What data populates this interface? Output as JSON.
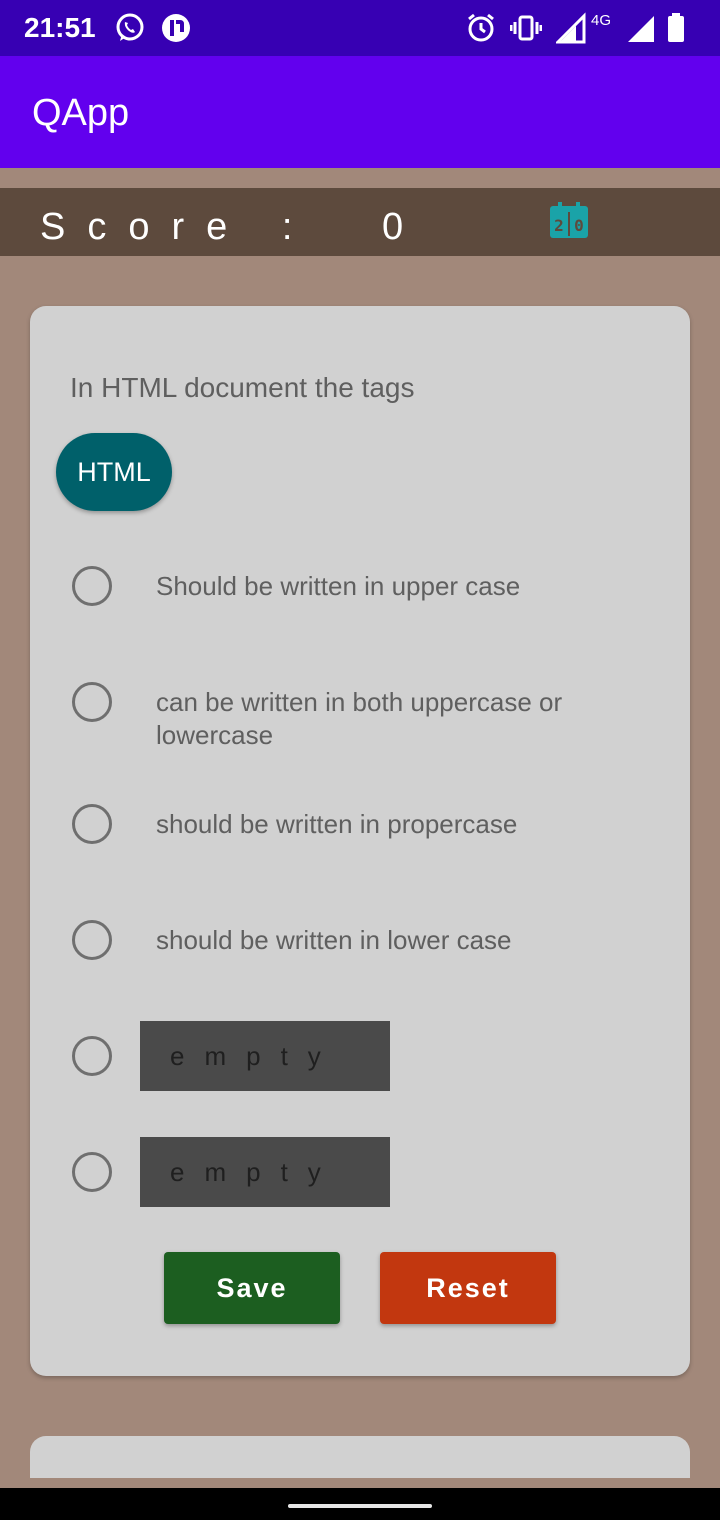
{
  "status_bar": {
    "time": "21:51",
    "network": "4G",
    "icons": [
      "whatsapp-icon",
      "app-notification-icon",
      "alarm-icon",
      "vibrate-icon",
      "signal-icon",
      "signal-full-icon",
      "battery-icon"
    ]
  },
  "app_bar": {
    "title": "QApp"
  },
  "score": {
    "label": "Score :",
    "value": "0",
    "icon": "scoreboard-icon"
  },
  "question": {
    "text": "In HTML document the tags",
    "tag": "HTML",
    "options": [
      "Should be written in upper case",
      "can be written in both uppercase or lowercase",
      "should be written in propercase",
      "should be written in lower case",
      "empty",
      "empty"
    ]
  },
  "buttons": {
    "save": "Save",
    "reset": "Reset"
  },
  "colors": {
    "status_bar": "#3700b3",
    "app_bar": "#6200ee",
    "background": "#a2887a",
    "score_bar": "#5d4a3d",
    "chip": "#00606a",
    "save": "#1c5e20",
    "reset": "#c2370f"
  }
}
